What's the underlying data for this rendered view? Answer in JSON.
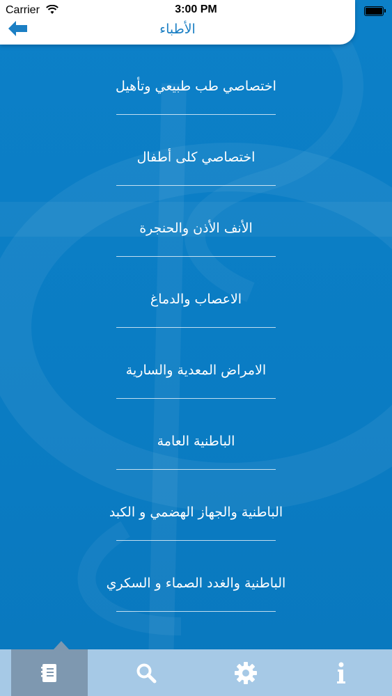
{
  "status_bar": {
    "carrier": "Carrier",
    "time": "3:00 PM"
  },
  "header": {
    "title": "الأطباء",
    "back_icon": "back-arrow-icon",
    "accent": "#1b7fc4"
  },
  "specialties": [
    {
      "label": "اختصاصي طب طبيعي وتأهيل"
    },
    {
      "label": "اختصاصي كلى أطفال"
    },
    {
      "label": "الأنف الأذن والحنجرة"
    },
    {
      "label": "الاعصاب والدماغ"
    },
    {
      "label": "الامراض المعدية والسارية"
    },
    {
      "label": "الباطنية العامة"
    },
    {
      "label": "الباطنية والجهاز الهضمي و الكبد"
    },
    {
      "label": "الباطنية والغدد الصماء و السكري"
    }
  ],
  "tabbar": {
    "tabs": [
      {
        "icon": "notebook-icon",
        "active": true
      },
      {
        "icon": "search-icon",
        "active": false
      },
      {
        "icon": "gear-icon",
        "active": false
      },
      {
        "icon": "info-icon",
        "active": false
      }
    ]
  },
  "colors": {
    "background": "#0b7fc6",
    "tabbar": "#a6c9e6",
    "tab_active": "#7e98b0"
  }
}
